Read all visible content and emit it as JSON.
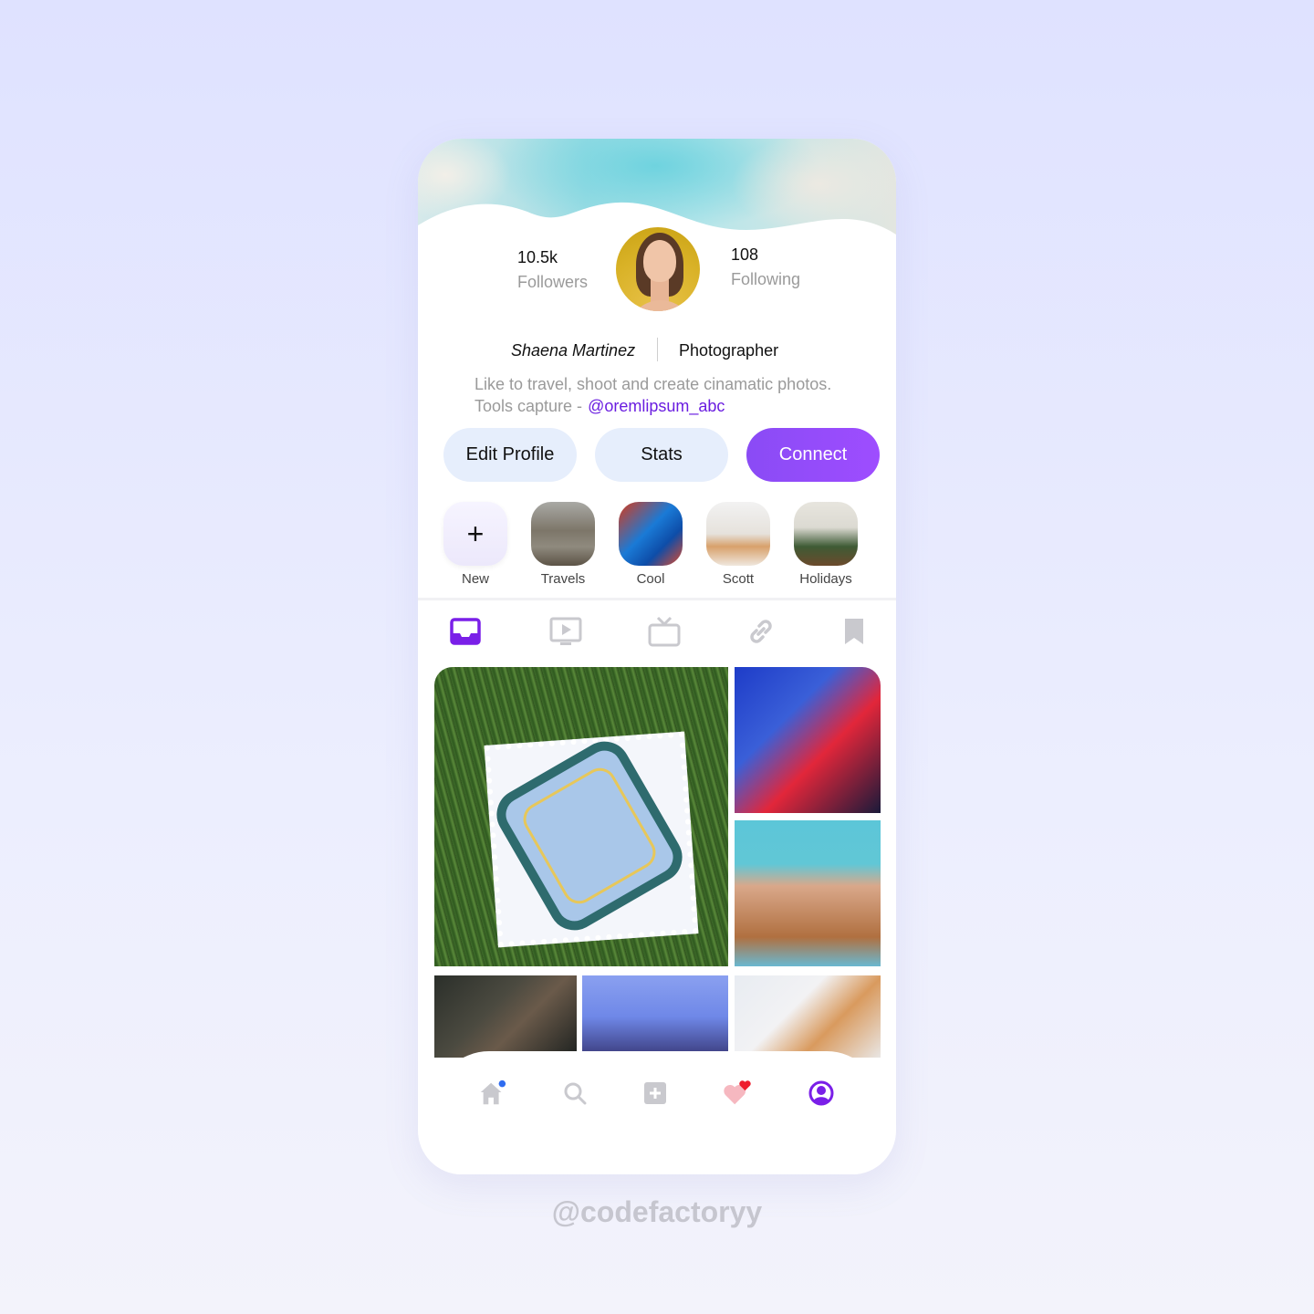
{
  "profile": {
    "followers_count": "10.5k",
    "followers_label": "Followers",
    "following_count": "108",
    "following_label": "Following",
    "name": "Shaena Martinez",
    "role": "Photographer",
    "bio_line1": "Like to travel, shoot and create cinamatic photos.",
    "bio_line2": "Tools capture -",
    "bio_handle": "@oremlipsum_abc"
  },
  "actions": {
    "edit_label": "Edit Profile",
    "stats_label": "Stats",
    "connect_label": "Connect"
  },
  "highlights": [
    {
      "label": "New",
      "icon": "plus-icon"
    },
    {
      "label": "Travels"
    },
    {
      "label": "Cool"
    },
    {
      "label": "Scott"
    },
    {
      "label": "Holidays"
    }
  ],
  "tabs": [
    {
      "name": "posts",
      "icon": "inbox-icon",
      "active": true
    },
    {
      "name": "videos",
      "icon": "play-icon",
      "active": false
    },
    {
      "name": "tv",
      "icon": "tv-icon",
      "active": false
    },
    {
      "name": "links",
      "icon": "link-icon",
      "active": false
    },
    {
      "name": "saved",
      "icon": "bookmark-icon",
      "active": false
    }
  ],
  "bottom_nav": [
    {
      "name": "home",
      "icon": "home-icon",
      "badge": true
    },
    {
      "name": "search",
      "icon": "search-icon"
    },
    {
      "name": "add",
      "icon": "plus-square-icon"
    },
    {
      "name": "activity",
      "icon": "heart-icon",
      "badge": true
    },
    {
      "name": "profile",
      "icon": "user-icon",
      "active": true
    }
  ],
  "colors": {
    "accent": "#7a1fe8",
    "connect_gradient_start": "#8a4bf5",
    "connect_gradient_end": "#9e4dff",
    "button_bg": "#e6eefc",
    "muted_icon": "#c9c9ce"
  },
  "watermark": "@codefactoryy"
}
